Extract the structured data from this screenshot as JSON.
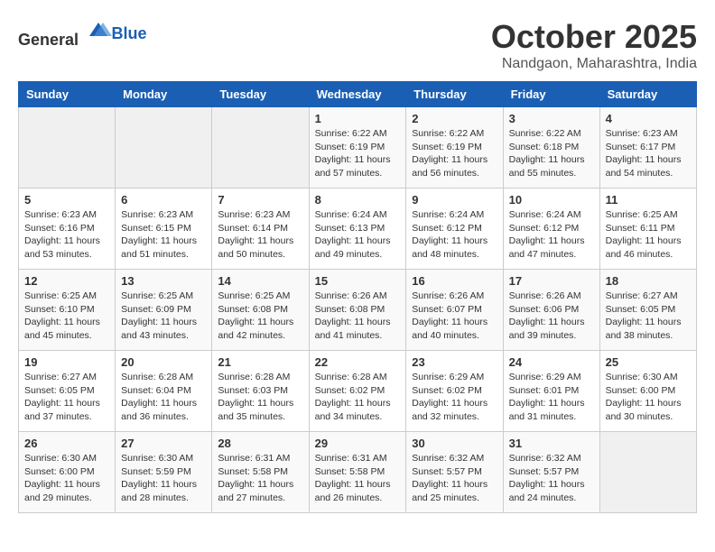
{
  "header": {
    "logo_general": "General",
    "logo_blue": "Blue",
    "month": "October 2025",
    "location": "Nandgaon, Maharashtra, India"
  },
  "weekdays": [
    "Sunday",
    "Monday",
    "Tuesday",
    "Wednesday",
    "Thursday",
    "Friday",
    "Saturday"
  ],
  "weeks": [
    [
      {
        "day": "",
        "info": ""
      },
      {
        "day": "",
        "info": ""
      },
      {
        "day": "",
        "info": ""
      },
      {
        "day": "1",
        "info": "Sunrise: 6:22 AM\nSunset: 6:19 PM\nDaylight: 11 hours\nand 57 minutes."
      },
      {
        "day": "2",
        "info": "Sunrise: 6:22 AM\nSunset: 6:19 PM\nDaylight: 11 hours\nand 56 minutes."
      },
      {
        "day": "3",
        "info": "Sunrise: 6:22 AM\nSunset: 6:18 PM\nDaylight: 11 hours\nand 55 minutes."
      },
      {
        "day": "4",
        "info": "Sunrise: 6:23 AM\nSunset: 6:17 PM\nDaylight: 11 hours\nand 54 minutes."
      }
    ],
    [
      {
        "day": "5",
        "info": "Sunrise: 6:23 AM\nSunset: 6:16 PM\nDaylight: 11 hours\nand 53 minutes."
      },
      {
        "day": "6",
        "info": "Sunrise: 6:23 AM\nSunset: 6:15 PM\nDaylight: 11 hours\nand 51 minutes."
      },
      {
        "day": "7",
        "info": "Sunrise: 6:23 AM\nSunset: 6:14 PM\nDaylight: 11 hours\nand 50 minutes."
      },
      {
        "day": "8",
        "info": "Sunrise: 6:24 AM\nSunset: 6:13 PM\nDaylight: 11 hours\nand 49 minutes."
      },
      {
        "day": "9",
        "info": "Sunrise: 6:24 AM\nSunset: 6:12 PM\nDaylight: 11 hours\nand 48 minutes."
      },
      {
        "day": "10",
        "info": "Sunrise: 6:24 AM\nSunset: 6:12 PM\nDaylight: 11 hours\nand 47 minutes."
      },
      {
        "day": "11",
        "info": "Sunrise: 6:25 AM\nSunset: 6:11 PM\nDaylight: 11 hours\nand 46 minutes."
      }
    ],
    [
      {
        "day": "12",
        "info": "Sunrise: 6:25 AM\nSunset: 6:10 PM\nDaylight: 11 hours\nand 45 minutes."
      },
      {
        "day": "13",
        "info": "Sunrise: 6:25 AM\nSunset: 6:09 PM\nDaylight: 11 hours\nand 43 minutes."
      },
      {
        "day": "14",
        "info": "Sunrise: 6:25 AM\nSunset: 6:08 PM\nDaylight: 11 hours\nand 42 minutes."
      },
      {
        "day": "15",
        "info": "Sunrise: 6:26 AM\nSunset: 6:08 PM\nDaylight: 11 hours\nand 41 minutes."
      },
      {
        "day": "16",
        "info": "Sunrise: 6:26 AM\nSunset: 6:07 PM\nDaylight: 11 hours\nand 40 minutes."
      },
      {
        "day": "17",
        "info": "Sunrise: 6:26 AM\nSunset: 6:06 PM\nDaylight: 11 hours\nand 39 minutes."
      },
      {
        "day": "18",
        "info": "Sunrise: 6:27 AM\nSunset: 6:05 PM\nDaylight: 11 hours\nand 38 minutes."
      }
    ],
    [
      {
        "day": "19",
        "info": "Sunrise: 6:27 AM\nSunset: 6:05 PM\nDaylight: 11 hours\nand 37 minutes."
      },
      {
        "day": "20",
        "info": "Sunrise: 6:28 AM\nSunset: 6:04 PM\nDaylight: 11 hours\nand 36 minutes."
      },
      {
        "day": "21",
        "info": "Sunrise: 6:28 AM\nSunset: 6:03 PM\nDaylight: 11 hours\nand 35 minutes."
      },
      {
        "day": "22",
        "info": "Sunrise: 6:28 AM\nSunset: 6:02 PM\nDaylight: 11 hours\nand 34 minutes."
      },
      {
        "day": "23",
        "info": "Sunrise: 6:29 AM\nSunset: 6:02 PM\nDaylight: 11 hours\nand 32 minutes."
      },
      {
        "day": "24",
        "info": "Sunrise: 6:29 AM\nSunset: 6:01 PM\nDaylight: 11 hours\nand 31 minutes."
      },
      {
        "day": "25",
        "info": "Sunrise: 6:30 AM\nSunset: 6:00 PM\nDaylight: 11 hours\nand 30 minutes."
      }
    ],
    [
      {
        "day": "26",
        "info": "Sunrise: 6:30 AM\nSunset: 6:00 PM\nDaylight: 11 hours\nand 29 minutes."
      },
      {
        "day": "27",
        "info": "Sunrise: 6:30 AM\nSunset: 5:59 PM\nDaylight: 11 hours\nand 28 minutes."
      },
      {
        "day": "28",
        "info": "Sunrise: 6:31 AM\nSunset: 5:58 PM\nDaylight: 11 hours\nand 27 minutes."
      },
      {
        "day": "29",
        "info": "Sunrise: 6:31 AM\nSunset: 5:58 PM\nDaylight: 11 hours\nand 26 minutes."
      },
      {
        "day": "30",
        "info": "Sunrise: 6:32 AM\nSunset: 5:57 PM\nDaylight: 11 hours\nand 25 minutes."
      },
      {
        "day": "31",
        "info": "Sunrise: 6:32 AM\nSunset: 5:57 PM\nDaylight: 11 hours\nand 24 minutes."
      },
      {
        "day": "",
        "info": ""
      }
    ]
  ]
}
